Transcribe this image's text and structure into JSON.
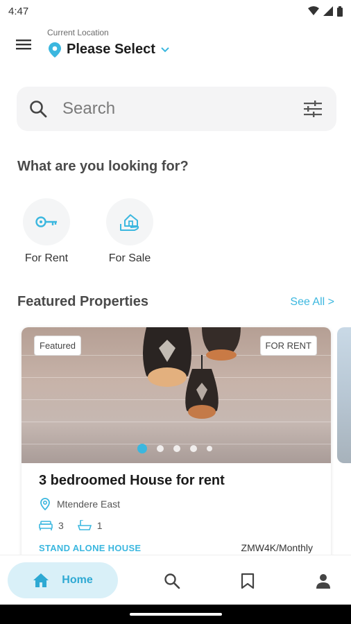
{
  "status_bar": {
    "time": "4:47"
  },
  "header": {
    "location_caption": "Current Location",
    "location_value": "Please Select"
  },
  "search": {
    "placeholder": "Search"
  },
  "categories_section": {
    "title": "What are you looking for?",
    "items": [
      {
        "label": "For Rent",
        "icon": "key-icon"
      },
      {
        "label": "For Sale",
        "icon": "house-hand-icon"
      }
    ]
  },
  "featured": {
    "title": "Featured Properties",
    "see_all": "See All >",
    "cards": [
      {
        "badge_featured": "Featured",
        "badge_status": "FOR RENT",
        "title": "3 bedroomed House for rent",
        "location": "Mtendere East",
        "bedrooms": "3",
        "bathrooms": "1",
        "type": "STAND ALONE HOUSE",
        "price": "ZMW4K/Monthly",
        "image_count": 5,
        "active_image": 1
      }
    ]
  },
  "bottom_nav": {
    "items": [
      {
        "label": "Home",
        "icon": "home-icon",
        "active": true
      },
      {
        "label": "",
        "icon": "search-icon",
        "active": false
      },
      {
        "label": "",
        "icon": "bookmark-icon",
        "active": false
      },
      {
        "label": "",
        "icon": "profile-icon",
        "active": false
      }
    ]
  },
  "colors": {
    "accent": "#3bb7df",
    "nav_active_bg": "#d9f0f8",
    "search_bg": "#f4f4f5"
  }
}
